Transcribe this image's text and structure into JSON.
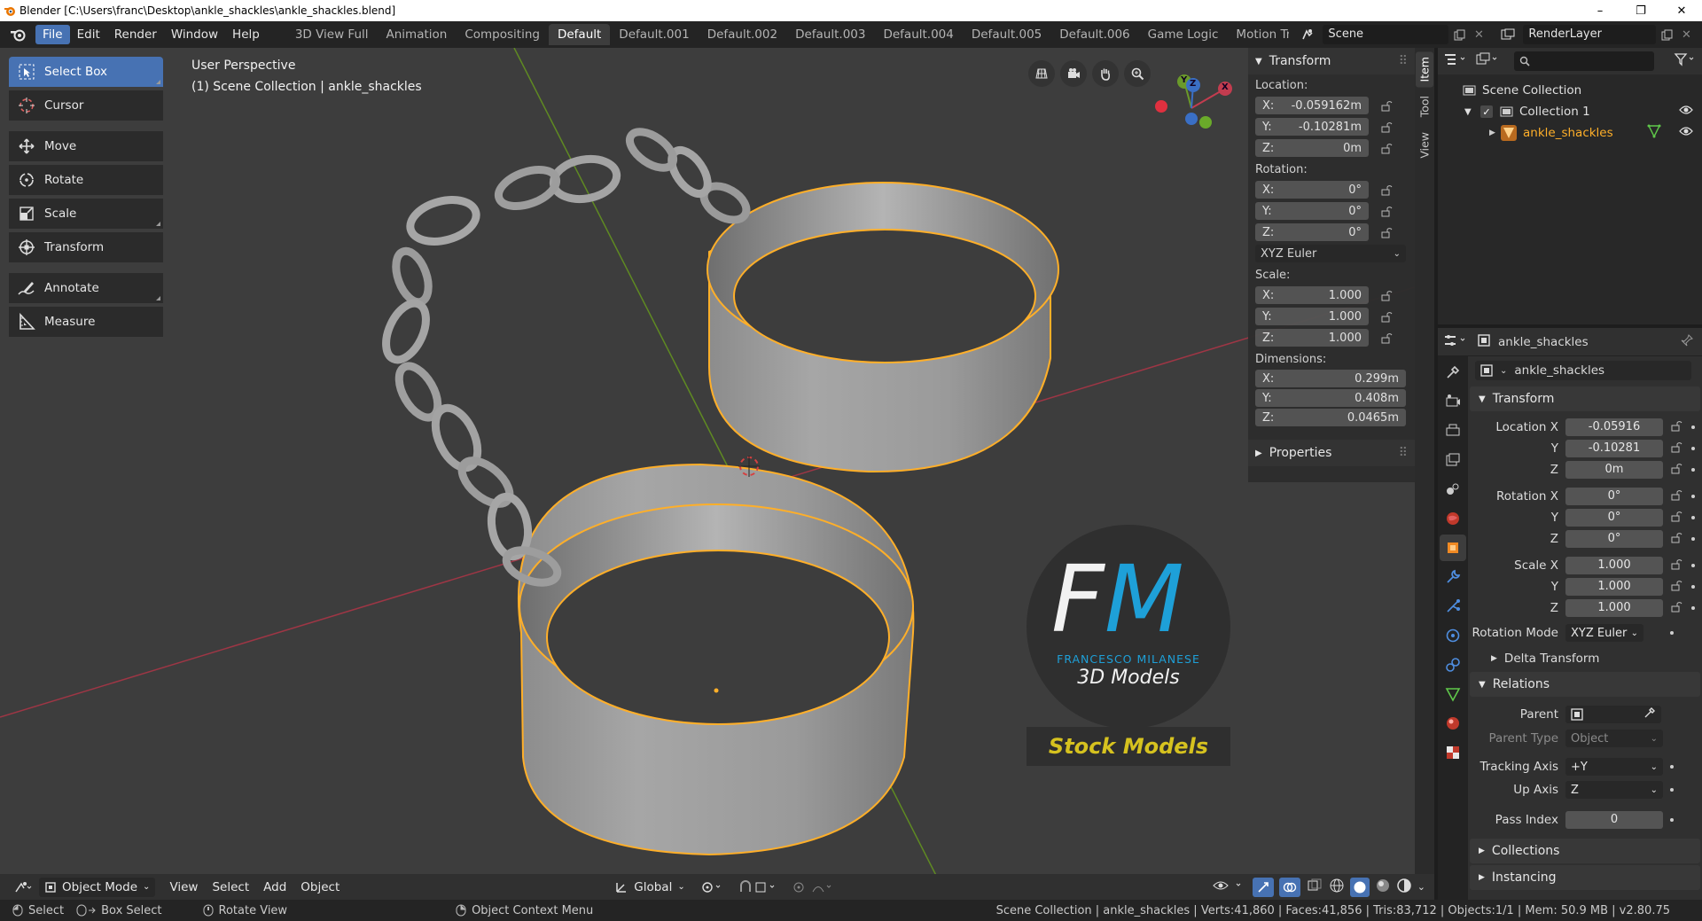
{
  "window": {
    "title": "Blender [C:\\Users\\franc\\Desktop\\ankle_shackles\\ankle_shackles.blend]",
    "minimize": "–",
    "maximize": "❐",
    "close": "✕"
  },
  "menu": [
    "File",
    "Edit",
    "Render",
    "Window",
    "Help"
  ],
  "workspaces": [
    "3D View Full",
    "Animation",
    "Compositing",
    "Default",
    "Default.001",
    "Default.002",
    "Default.003",
    "Default.004",
    "Default.005",
    "Default.006",
    "Game Logic",
    "Motion Trac"
  ],
  "active_workspace": "Default",
  "scene": {
    "name": "Scene",
    "render_layer": "RenderLayer"
  },
  "tools": [
    {
      "label": "Select Box",
      "icon": "select-box-icon",
      "active": true
    },
    {
      "label": "Cursor",
      "icon": "cursor-icon"
    },
    {
      "label": "Move",
      "icon": "move-icon"
    },
    {
      "label": "Rotate",
      "icon": "rotate-icon"
    },
    {
      "label": "Scale",
      "icon": "scale-icon"
    },
    {
      "label": "Transform",
      "icon": "transform-icon"
    },
    {
      "label": "Annotate",
      "icon": "annotate-icon"
    },
    {
      "label": "Measure",
      "icon": "measure-icon"
    }
  ],
  "viewport": {
    "perspective": "User Perspective",
    "collection_info": "(1) Scene Collection | ankle_shackles",
    "gizmo_axes": {
      "x": "X",
      "y": "Y",
      "z": "Z"
    },
    "watermark": {
      "initials_a": "F",
      "initials_b": "M",
      "name": "FRANCESCO MILANESE",
      "subtitle": "3D Models",
      "banner": "Stock Models"
    }
  },
  "npanel": {
    "title": "Transform",
    "location_label": "Location:",
    "location": {
      "x": "-0.059162m",
      "y": "-0.10281m",
      "z": "0m"
    },
    "rotation_label": "Rotation:",
    "rotation": {
      "x": "0°",
      "y": "0°",
      "z": "0°"
    },
    "rotation_mode": "XYZ Euler",
    "scale_label": "Scale:",
    "scale": {
      "x": "1.000",
      "y": "1.000",
      "z": "1.000"
    },
    "dimensions_label": "Dimensions:",
    "dimensions": {
      "x": "0.299m",
      "y": "0.408m",
      "z": "0.0465m"
    },
    "properties_label": "Properties",
    "axis": {
      "x": "X:",
      "y": "Y:",
      "z": "Z:"
    },
    "tabs": [
      "Item",
      "Tool",
      "View"
    ]
  },
  "viewport_header": {
    "mode": "Object Mode",
    "menus": [
      "View",
      "Select",
      "Add",
      "Object"
    ],
    "orientation": "Global"
  },
  "outliner": {
    "search_placeholder": "",
    "root": "Scene Collection",
    "collection": "Collection 1",
    "object": "ankle_shackles"
  },
  "properties": {
    "object_name": "ankle_shackles",
    "datablock_name": "ankle_shackles",
    "transform_label": "Transform",
    "location_x_label": "Location X",
    "location": {
      "x": "-0.05916",
      "y": "-0.10281",
      "z": "0m"
    },
    "rotation_x_label": "Rotation X",
    "rotation": {
      "x": "0°",
      "y": "0°",
      "z": "0°"
    },
    "scale_x_label": "Scale X",
    "scale": {
      "x": "1.000",
      "y": "1.000",
      "z": "1.000"
    },
    "axis_y": "Y",
    "axis_z": "Z",
    "rotation_mode_label": "Rotation Mode",
    "rotation_mode": "XYZ Euler",
    "delta_transform": "Delta Transform",
    "relations_label": "Relations",
    "parent_label": "Parent",
    "parent_type_label": "Parent Type",
    "parent_type": "Object",
    "tracking_axis_label": "Tracking Axis",
    "tracking_axis": "+Y",
    "up_axis_label": "Up Axis",
    "up_axis": "Z",
    "pass_index_label": "Pass Index",
    "pass_index": "0",
    "collections_label": "Collections",
    "instancing_label": "Instancing"
  },
  "statusbar": {
    "select": "Select",
    "box_select": "Box Select",
    "rotate_view": "Rotate View",
    "context_menu": "Object Context Menu",
    "stats": "Scene Collection | ankle_shackles | Verts:41,860 | Faces:41,856 | Tris:83,712 | Objects:1/1 | Mem: 50.9 MB | v2.80.75"
  },
  "colors": {
    "accent": "#4772b3",
    "selection": "#ffaf29",
    "viewport_bg": "#3d3d3d",
    "x_axis": "#c33c4f",
    "y_axis": "#6a9a2a",
    "watermark_blue": "#1ea0d8",
    "watermark_banner": "#d6c21f"
  }
}
